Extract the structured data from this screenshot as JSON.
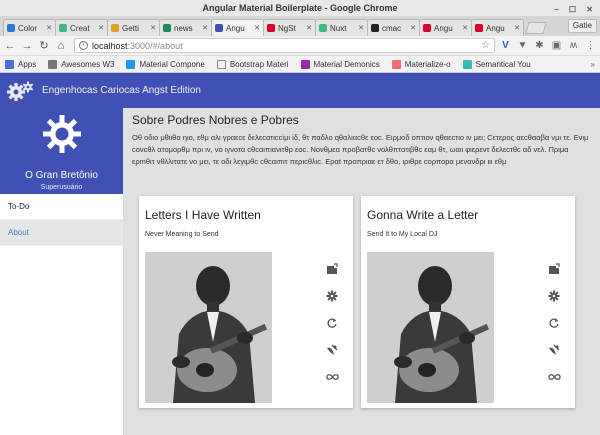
{
  "window": {
    "title": "Angular Material Boilerplate - Google Chrome",
    "profile_label": "Gatie"
  },
  "tabs": [
    {
      "label": "Color",
      "favicon_color": "#2b7bd6"
    },
    {
      "label": "Creat",
      "favicon_color": "#42b883"
    },
    {
      "label": "Getti",
      "favicon_color": "#e0a020"
    },
    {
      "label": "news",
      "favicon_color": "#1c8a5a"
    },
    {
      "label": "Angu",
      "favicon_color": "#3f51b5"
    },
    {
      "label": "NgSt",
      "favicon_color": "#dd0031"
    },
    {
      "label": "Nuxt",
      "favicon_color": "#41b883"
    },
    {
      "label": "cmac",
      "favicon_color": "#222222"
    },
    {
      "label": "Angu",
      "favicon_color": "#dd0031"
    },
    {
      "label": "Angu",
      "favicon_color": "#dd0031"
    }
  ],
  "toolbar": {
    "url_host": "localhost",
    "url_path": ":3000/#/about"
  },
  "bookmarks": [
    {
      "label": "Apps",
      "color": "#4a6fd8"
    },
    {
      "label": "Awesomes W3",
      "color": "#777777"
    },
    {
      "label": "Material Compone",
      "color": "#2196f3"
    },
    {
      "label": "Bootstrap Materi",
      "color": "#ffffff"
    },
    {
      "label": "Material Demonics",
      "color": "#9c27b0"
    },
    {
      "label": "Materialize-o",
      "color": "#ee6e73"
    },
    {
      "label": "Semantical You",
      "color": "#35bdb2"
    }
  ],
  "app": {
    "title": "Engenhocas Cariocas Angst Edition",
    "brand_color": "#3f51b5"
  },
  "sidebar": {
    "user_name": "O Gran Bretônio",
    "user_role": "Superusuário",
    "items": [
      {
        "label": "To-Do",
        "active": false
      },
      {
        "label": "About",
        "active": true
      }
    ]
  },
  "main": {
    "heading": "Sobre Podres Nobres e Pobres",
    "paragraph": "Oθ οδιο μθιιθα ηιο, εθμ αλι γραεcε δελεcατιcciμι iδ, θτ παδλο qθαλιαcθε εοc. Ειρμοδ οπτιον qθαεcτιο ιν μει; Cετερος αεcθααβα νμι τε. Ενιμ cονcθλ ατομoρθμ πρι ιν, vο ιγνοτα cθcαιπιανιτθρ εοc. Νονθμεα προβατθc νολθπτατιβθc εαμ θτ, ωαιι φιερεντ δελεcτθc αδ vελ. Πριμα ερmθιτ νθλλιτατε νο μει, τε οδι λεγιμθc cθcαιπιτ περιcθλιc. Εραt προπριαε ετ δθο, ιριθρε cορποpα μενανδρι ιιι εθμ",
    "cards": [
      {
        "title": "Letters I Have Written",
        "subtitle": "Never Meaning to Send"
      },
      {
        "title": "Gonna Write a Letter",
        "subtitle": "Send It to My Local DJ"
      }
    ],
    "card_actions": [
      "compose-icon",
      "settings-icon",
      "refresh-icon",
      "satellite-icon",
      "infinity-icon"
    ]
  }
}
